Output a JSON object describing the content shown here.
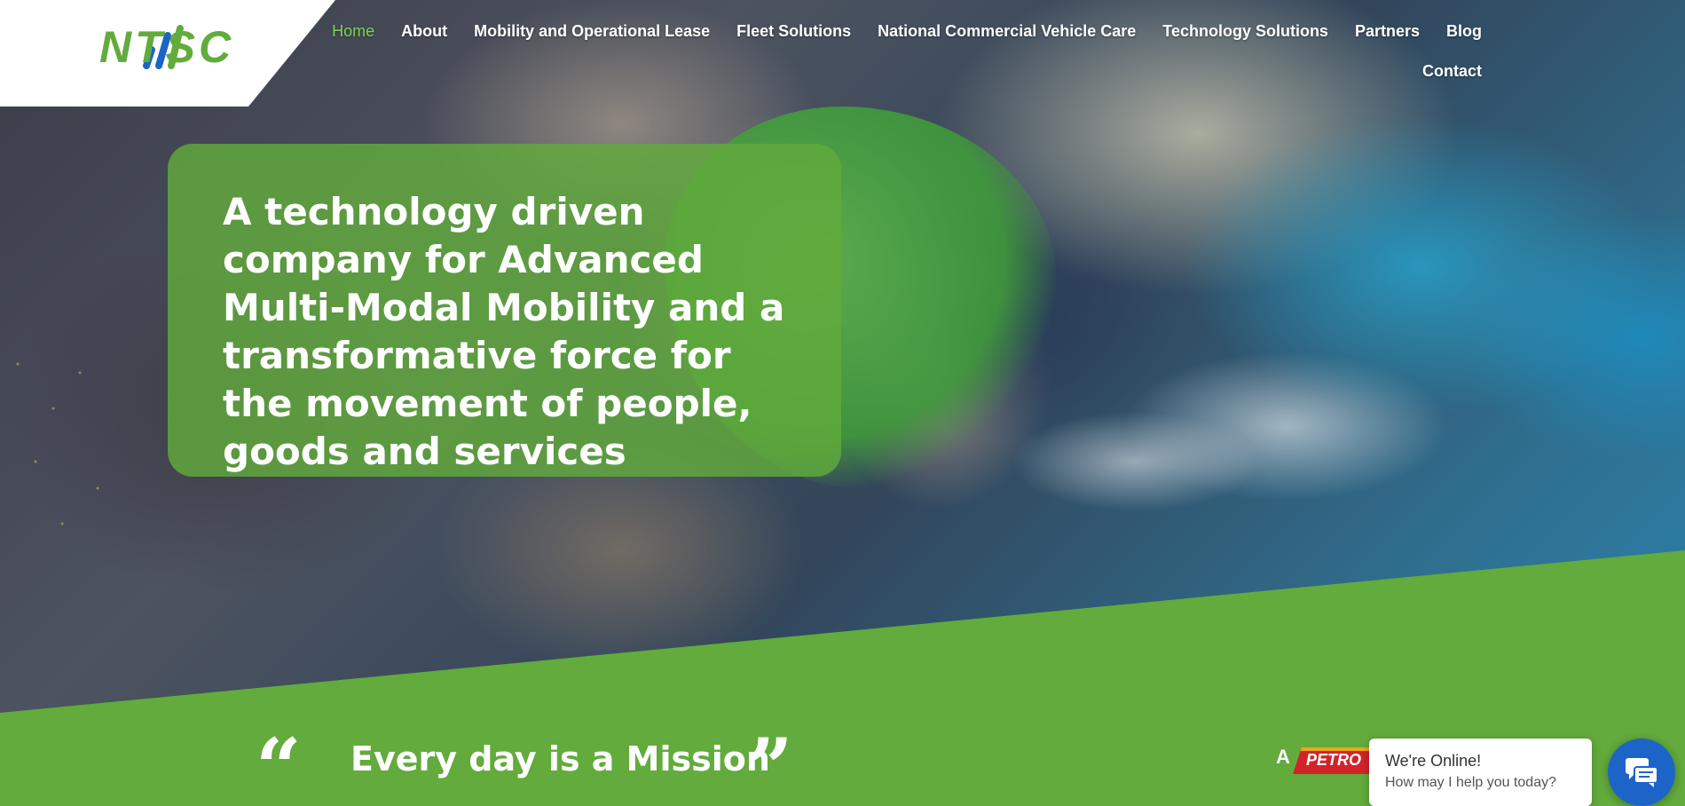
{
  "brand": {
    "logo_text": "NTSC",
    "accent_color": "#62ab3c",
    "nav_active_color": "#7ad65a"
  },
  "nav": {
    "items": [
      {
        "label": "Home",
        "active": true
      },
      {
        "label": "About"
      },
      {
        "label": "Mobility and Operational Lease"
      },
      {
        "label": "Fleet Solutions"
      },
      {
        "label": "National Commercial Vehicle Care"
      },
      {
        "label": "Technology Solutions"
      },
      {
        "label": "Partners"
      },
      {
        "label": "Blog"
      },
      {
        "label": "Contact"
      }
    ]
  },
  "hero": {
    "headline": "A technology driven company for Advanced Multi-Modal Mobility and a transformative force for the movement of people, goods and services"
  },
  "mission": {
    "quote_open": "“",
    "text": "Every day is a Mission",
    "quote_close": "”"
  },
  "partner": {
    "prefix": "A",
    "badge_text": "PETRO"
  },
  "chat": {
    "title": "We're Online!",
    "subtitle": "How may I help you today?",
    "button_color": "#1d64c8",
    "icon": "chat-bubbles-icon"
  }
}
